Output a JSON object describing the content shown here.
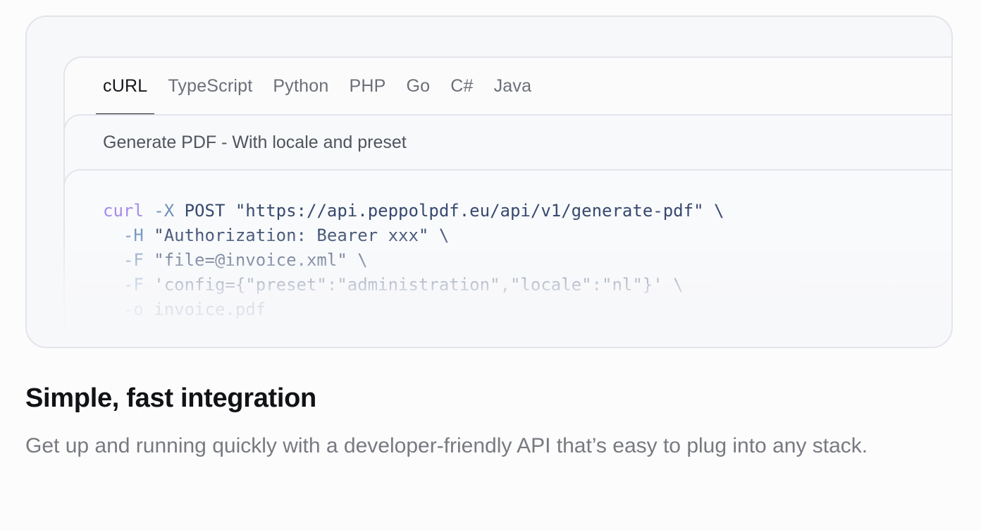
{
  "tabs": [
    {
      "label": "cURL",
      "active": true
    },
    {
      "label": "TypeScript",
      "active": false
    },
    {
      "label": "Python",
      "active": false
    },
    {
      "label": "PHP",
      "active": false
    },
    {
      "label": "Go",
      "active": false
    },
    {
      "label": "C#",
      "active": false
    },
    {
      "label": "Java",
      "active": false
    }
  ],
  "example": {
    "title": "Generate PDF - With locale and preset"
  },
  "code": {
    "line1": {
      "cmd": "curl",
      "flag": " -X",
      "rest": " POST \"https://api.peppolpdf.eu/api/v1/generate-pdf\" \\"
    },
    "line2": {
      "flag": "  -H",
      "rest": " \"Authorization: Bearer xxx\" \\"
    },
    "line3": {
      "flag": "  -F",
      "rest": " \"file=@invoice.xml\" \\"
    },
    "line4": {
      "flag": "  -F",
      "rest": " 'config={\"preset\":\"administration\",\"locale\":\"nl\"}' \\"
    },
    "line5": {
      "flag": "  -o",
      "rest": " invoice.pdf"
    }
  },
  "section": {
    "heading": "Simple, fast integration",
    "description": "Get up and running quickly with a developer-friendly API that’s easy to plug into any stack."
  },
  "colors": {
    "active_tab": "#15171c",
    "inactive_tab": "#6b6f78",
    "code_keyword": "#a68bea",
    "code_flag": "#6f8fbb",
    "code_text": "#37496e"
  }
}
